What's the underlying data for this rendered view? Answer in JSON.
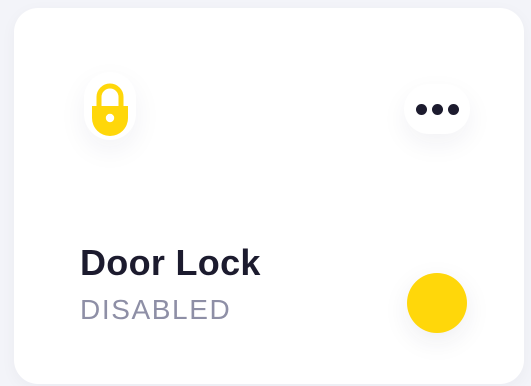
{
  "colors": {
    "accent": "#ffd70a",
    "title": "#1c1b2e",
    "status": "#8e8fa6",
    "dots": "#1c1b2e",
    "card": "#ffffff"
  },
  "device": {
    "icon": "lock-icon",
    "name": "Door Lock",
    "status": "DISABLED",
    "menu_icon": "more-horizontal-icon",
    "toggle_icon": "toggle-knob-icon"
  }
}
